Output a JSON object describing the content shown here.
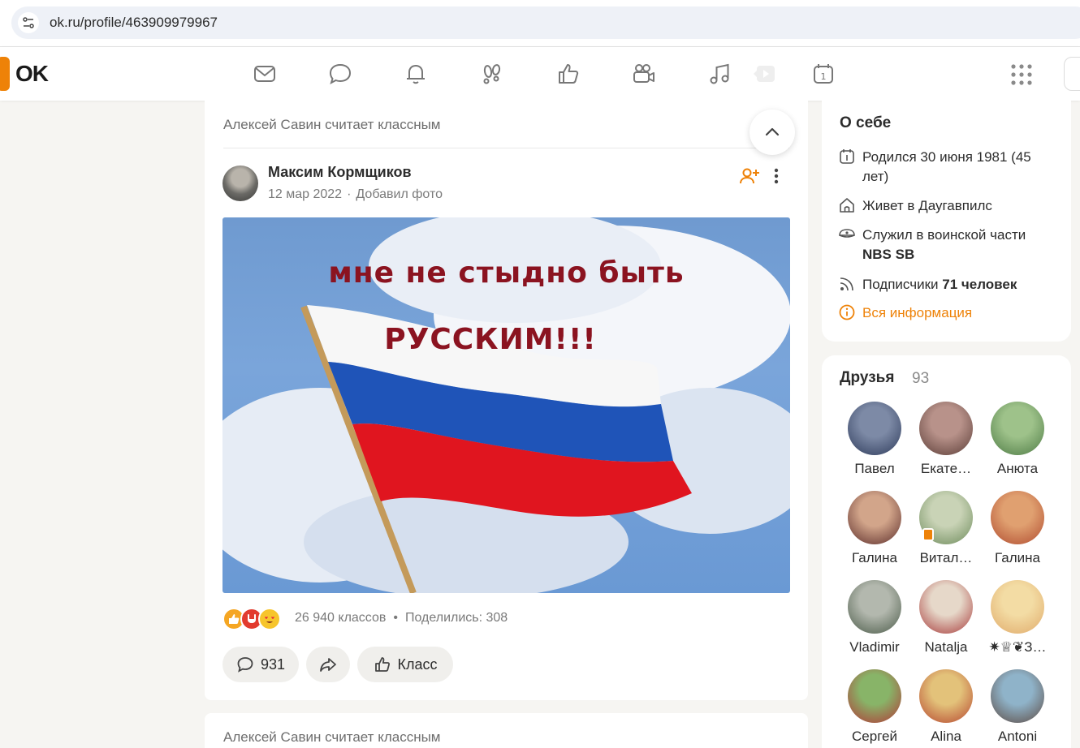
{
  "browser": {
    "url": "ok.ru/profile/463909979967"
  },
  "header": {
    "logo_text": "OK",
    "nav_icons": [
      "mail-icon",
      "chat-icon",
      "bell-icon",
      "guests-icon",
      "like-icon",
      "video-camera-icon",
      "music-icon",
      "video-play-icon",
      "calendar-icon"
    ],
    "brand_color": "#ee8208"
  },
  "feed": {
    "post": {
      "liked_by": "Алексей Савин считает классным",
      "author": "Максим Кормщиков",
      "date": "12 мар 2022",
      "action": "Добавил фото",
      "image_text_line1": "мне не стыдно быть",
      "image_text_line2": "РУССКИМ!!!",
      "reactions_count": "26 940 классов",
      "shares": "Поделились: 308",
      "comments_count": "931",
      "like_label": "Класс"
    },
    "next_post": {
      "liked_by": "Алексей Савин считает классным"
    }
  },
  "about": {
    "title": "О себе",
    "born": "Родился 30 июня 1981 (45 лет)",
    "lives": "Живет в Даугавпилс",
    "served_prefix": "Служил в воинской части",
    "served_unit": "NBS SB",
    "followers_prefix": "Подписчики",
    "followers_count": "71 человек",
    "all_info": "Вся информация"
  },
  "friends": {
    "title": "Друзья",
    "count": "93",
    "list": [
      {
        "name": "Павел",
        "colors": [
          "#7d8aa6",
          "#2d3a5a"
        ]
      },
      {
        "name": "Екате…",
        "colors": [
          "#b8928a",
          "#5a3c36"
        ]
      },
      {
        "name": "Анюта",
        "colors": [
          "#9ec28a",
          "#4d7a44"
        ]
      },
      {
        "name": "Галина",
        "colors": [
          "#d2a58a",
          "#5b2c2a"
        ]
      },
      {
        "name": "Витал…",
        "colors": [
          "#c9d3b6",
          "#6c8a5a"
        ]
      },
      {
        "name": "Галина",
        "colors": [
          "#e0a070",
          "#b04b2f"
        ]
      },
      {
        "name": "Vladimir",
        "colors": [
          "#b3b8ae",
          "#4a5a48"
        ]
      },
      {
        "name": "Natalja",
        "colors": [
          "#e6d8c9",
          "#a73a3a"
        ]
      },
      {
        "name": "✷♕❦З…",
        "colors": [
          "#f3dca4",
          "#e0aa6a"
        ]
      },
      {
        "name": "Сергей",
        "colors": [
          "#88b468",
          "#b23636"
        ]
      },
      {
        "name": "Alina",
        "colors": [
          "#e3c27a",
          "#b5452e"
        ]
      },
      {
        "name": "Antoni",
        "colors": [
          "#8fb3c9",
          "#5d4a42"
        ]
      }
    ]
  }
}
